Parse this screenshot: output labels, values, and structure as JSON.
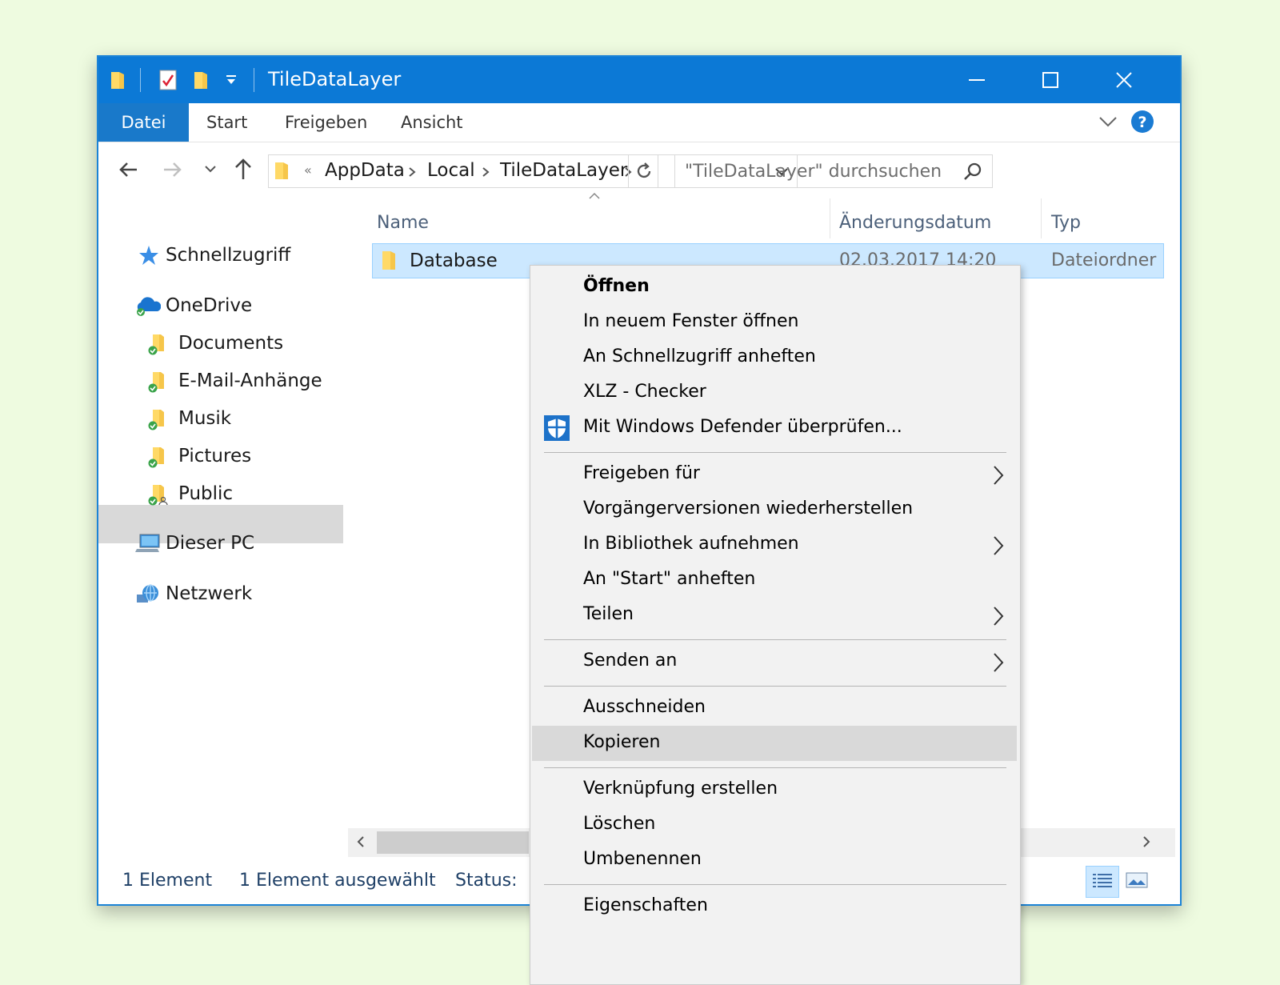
{
  "window": {
    "title": "TileDataLayer"
  },
  "ribbon": {
    "tabs": [
      "Datei",
      "Start",
      "Freigeben",
      "Ansicht"
    ]
  },
  "address": {
    "overflow": "«",
    "crumbs": [
      "AppData",
      "Local",
      "TileDataLayer"
    ],
    "search_placeholder": "\"TileDataLayer\" durchsuchen"
  },
  "sidebar": {
    "quick_access": "Schnellzugriff",
    "onedrive": "OneDrive",
    "onedrive_items": [
      "Documents",
      "E-Mail-Anhänge",
      "Musik",
      "Pictures",
      "Public"
    ],
    "this_pc": "Dieser PC",
    "network": "Netzwerk"
  },
  "filelist": {
    "columns": [
      "Name",
      "Änderungsdatum",
      "Typ"
    ],
    "rows": [
      {
        "name": "Database",
        "date": "02.03.2017 14:20",
        "type": "Dateiordner"
      }
    ]
  },
  "context_menu": {
    "groups": [
      [
        "Öffnen",
        "In neuem Fenster öffnen",
        "An Schnellzugriff anheften",
        "XLZ - Checker",
        "Mit Windows Defender überprüfen..."
      ],
      [
        "Freigeben für",
        "Vorgängerversionen wiederherstellen",
        "In Bibliothek aufnehmen",
        "An \"Start\" anheften",
        "Teilen"
      ],
      [
        "Senden an"
      ],
      [
        "Ausschneiden",
        "Kopieren"
      ],
      [
        "Verknüpfung erstellen",
        "Löschen",
        "Umbenennen"
      ],
      [
        "Eigenschaften"
      ]
    ],
    "highlighted": "Kopieren"
  },
  "statusbar": {
    "count": "1 Element",
    "selected": "1 Element ausgewählt",
    "status": "Status:"
  },
  "colors": {
    "titlebar": "#0c79d6",
    "file_tab": "#1979ca",
    "selection": "#cce8ff",
    "background": "#eefbe0"
  }
}
